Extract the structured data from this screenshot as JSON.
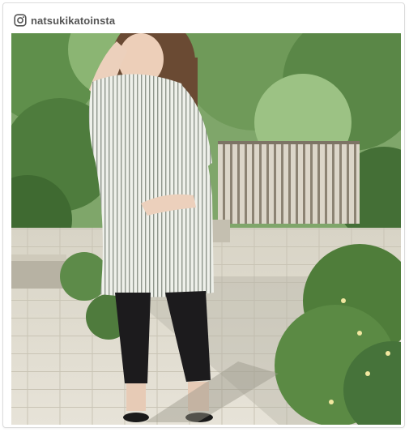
{
  "post": {
    "username": "natsukikatoinsta",
    "icon": "instagram-icon",
    "colors": {
      "header_text": "#555555",
      "card_border": "#dcdcdc"
    }
  }
}
